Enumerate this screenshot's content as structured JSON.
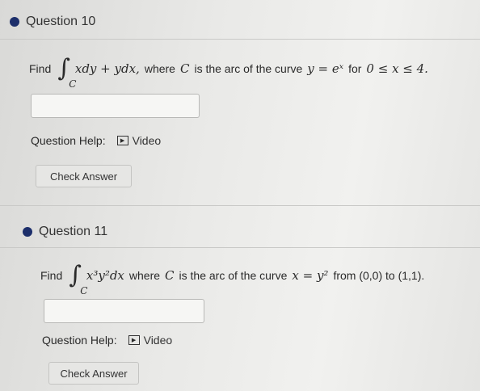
{
  "q10": {
    "title": "Question 10",
    "find": "Find",
    "sub": "C",
    "integrand": "xdy + ydx,",
    "text1": "where",
    "cvar": "C",
    "text2": "is the arc of the curve",
    "curve": "y = eˣ",
    "text3": "for",
    "range": "0 ≤ x ≤ 4.",
    "help_label": "Question Help:",
    "video_label": "Video",
    "check_label": "Check Answer"
  },
  "q11": {
    "title": "Question 11",
    "find": "Find",
    "sub": "C",
    "integrand": "x³y²dx",
    "text1": "where",
    "cvar": "C",
    "text2": "is the arc of the curve",
    "curve": "x = y²",
    "text3": "from (0,0) to (1,1).",
    "help_label": "Question Help:",
    "video_label": "Video",
    "check_label": "Check Answer"
  }
}
